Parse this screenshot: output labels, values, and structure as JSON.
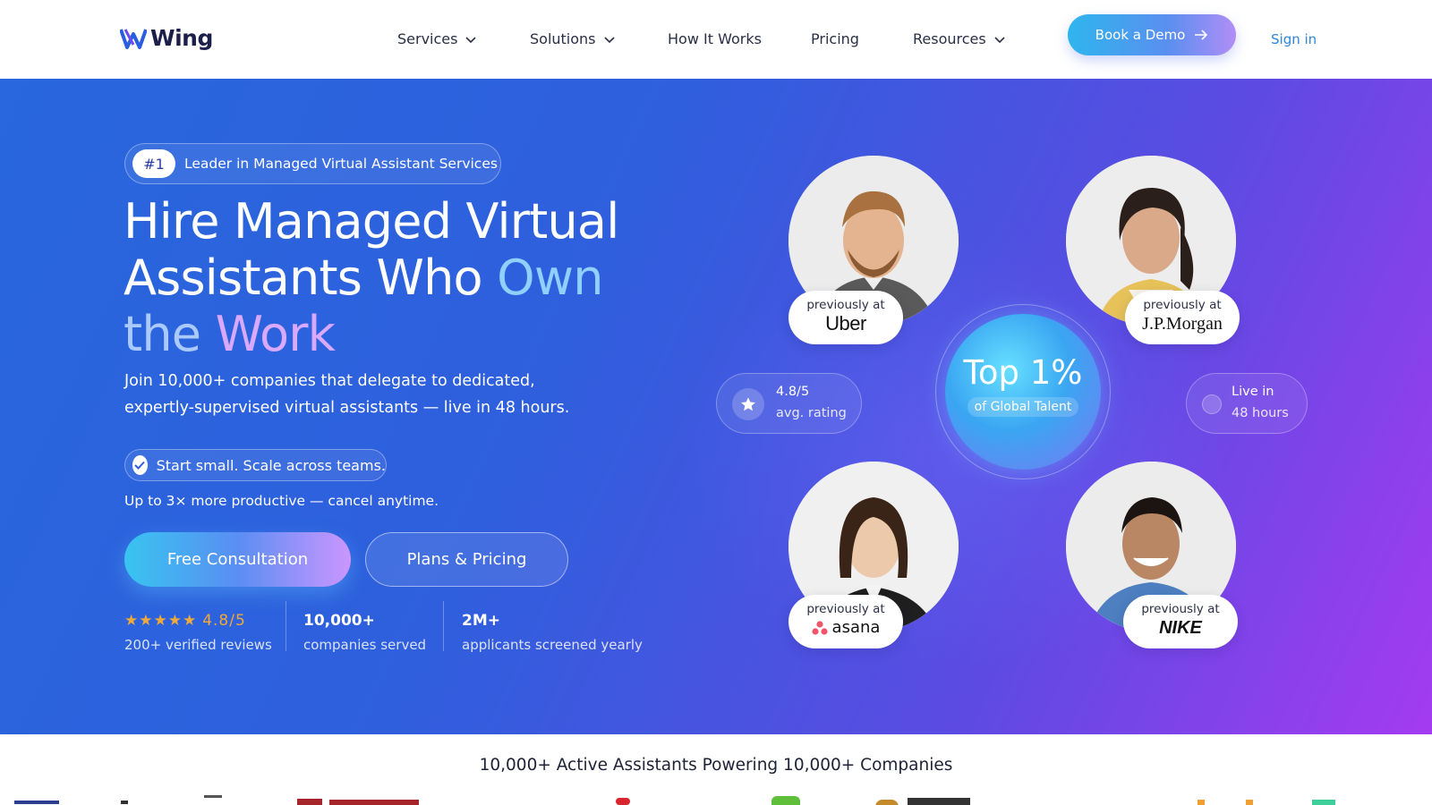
{
  "brand": {
    "name": "Wing"
  },
  "nav": {
    "items": [
      {
        "label": "Services",
        "dropdown": true
      },
      {
        "label": "Solutions",
        "dropdown": true
      },
      {
        "label": "How It Works",
        "dropdown": false
      },
      {
        "label": "Pricing",
        "dropdown": false
      },
      {
        "label": "Resources",
        "dropdown": true
      }
    ],
    "demo_label": "Book a Demo",
    "signin_label": "Sign in"
  },
  "hero": {
    "badge_num": "#1",
    "badge_text": "Leader in Managed Virtual Assistant Services",
    "headline_1": "Hire Managed Virtual",
    "headline_2a": "Assistants Who",
    "headline_2b": "Own",
    "headline_3a": "the",
    "headline_3b": "Work",
    "sub_1": "Join 10,000+ companies that delegate to dedicated,",
    "sub_2": "expertly-supervised virtual assistants — live in 48 hours.",
    "check_text": "Start small. Scale across teams.",
    "note": "Up to 3× more productive — cancel anytime.",
    "cta_primary": "Free Consultation",
    "cta_secondary": "Plans & Pricing",
    "stats": [
      {
        "value": "4.8/5",
        "label": "200+ verified reviews",
        "stars": "★★★★★"
      },
      {
        "value": "10,000+",
        "label": "companies served"
      },
      {
        "value": "2M+",
        "label": "applicants screened yearly"
      }
    ]
  },
  "talent": {
    "prev_label": "previously at",
    "cards": [
      {
        "brand": "Uber"
      },
      {
        "brand": "J.P.Morgan"
      },
      {
        "brand": "asana"
      },
      {
        "brand": "NIKE"
      }
    ],
    "top_title": "Top 1%",
    "top_sub": "of Global Talent",
    "rating_value": "4.8/5",
    "rating_label": "avg. rating",
    "live_title": "Live in",
    "live_value": "48 hours"
  },
  "strip": {
    "title": "10,000+ Active Assistants Powering 10,000+ Companies"
  },
  "colors": {
    "accent": "#2f86d6",
    "hero_start": "#2867dd",
    "hero_end": "#a43bf0",
    "star": "#f0a93a"
  }
}
